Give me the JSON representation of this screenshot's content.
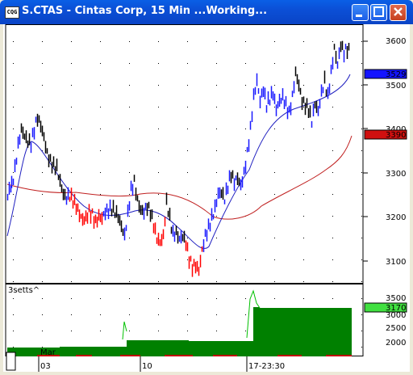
{
  "window": {
    "title": "S.CTAS - Cintas Corp, 15 Min ...Working...",
    "icon_label": "CQG"
  },
  "price_pane": {
    "y_ticks": [
      "3600",
      "3500",
      "3400",
      "3300",
      "3200",
      "3100"
    ],
    "last_price_tag": "3529",
    "ma_tag": "3390",
    "last_tag_color": "#1414ff",
    "ma_tag_color": "#d01010"
  },
  "indicator_pane": {
    "label": "3setts^",
    "y_ticks": [
      "3500",
      "3000",
      "2500",
      "2000"
    ],
    "value_tag": "3170",
    "value_tag_color": "#00c000"
  },
  "time_axis": {
    "labels": [
      "Mar",
      "03",
      "10",
      "17-23:30"
    ]
  },
  "colors": {
    "up": "#1a1aff",
    "down": "#000000",
    "red_bars": "#ff0000",
    "fast_ma": "#2020c0",
    "slow_ma": "#c02020",
    "histogram": "#008000"
  }
}
